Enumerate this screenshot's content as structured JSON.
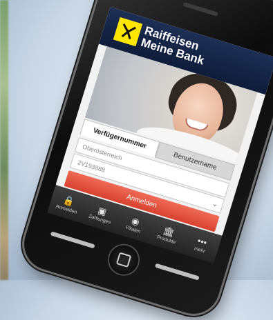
{
  "app": {
    "brand_line1": "Raiffeisen",
    "brand_line2": "Meine Bank"
  },
  "login": {
    "tabs": [
      {
        "label": "Verfügernummer",
        "active": true
      },
      {
        "label": "Benutzername",
        "active": false
      }
    ],
    "field1_value": "Oberösterreich",
    "field2_value": "2V193888",
    "submit_label": "Anmelden"
  },
  "nav": {
    "items": [
      {
        "label": "Anmelden",
        "icon": "lock-icon"
      },
      {
        "label": "Zahlungen",
        "icon": "payments-icon"
      },
      {
        "label": "Filialen",
        "icon": "location-icon"
      },
      {
        "label": "Produkte",
        "icon": "bank-icon"
      },
      {
        "label": "mehr",
        "icon": "more-icon"
      }
    ]
  },
  "colors": {
    "header": "#1d2f55",
    "logo": "#ffe600",
    "button": "#d8422f"
  }
}
